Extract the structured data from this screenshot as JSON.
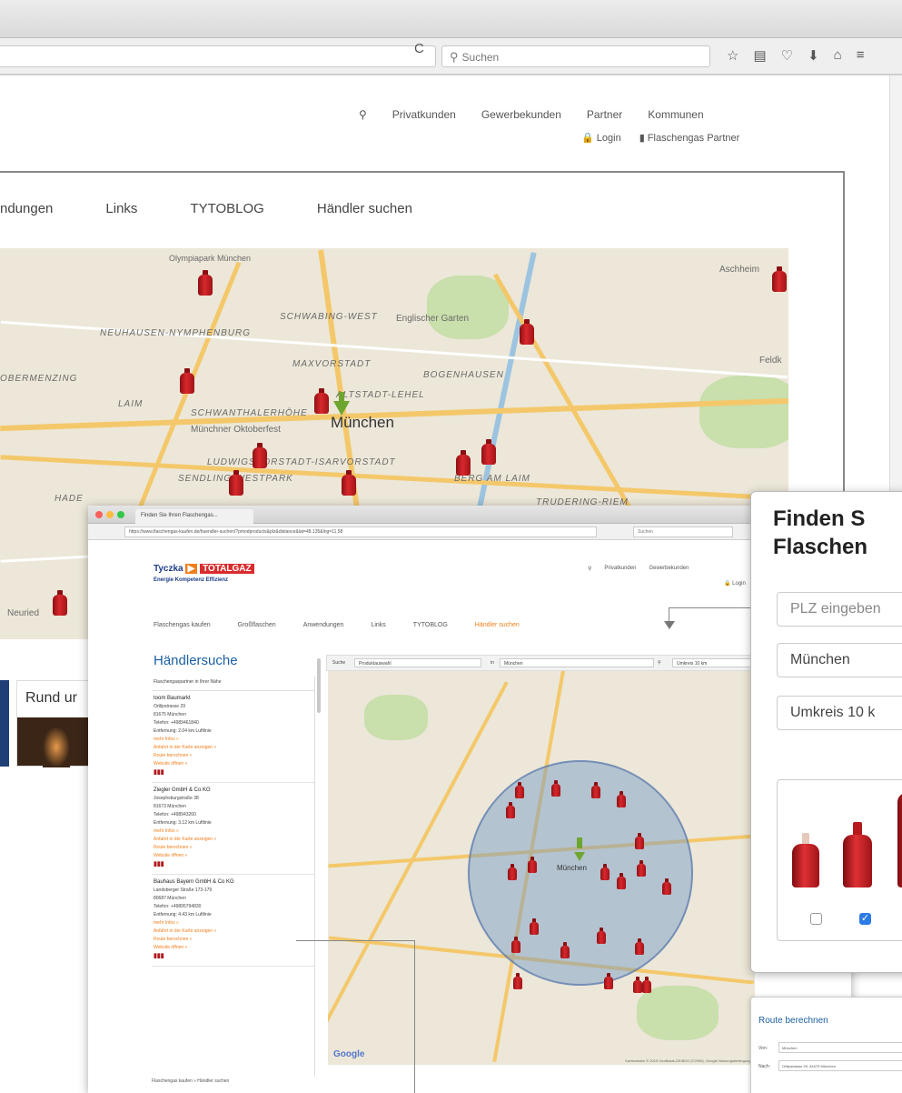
{
  "browser": {
    "search_placeholder": "Suchen",
    "reload_glyph": "C",
    "toolbar_icons": [
      "star-icon",
      "bookmarks-icon",
      "pocket-icon",
      "download-icon",
      "home-icon",
      "menu-icon"
    ]
  },
  "site": {
    "top_nav": [
      "Privatkunden",
      "Gewerbekunden",
      "Partner",
      "Kommunen"
    ],
    "login": "Login",
    "partner_link": "Flaschengas Partner",
    "main_nav": [
      "ndungen",
      "Links",
      "TYTOBLOG",
      "Händler suchen"
    ]
  },
  "map": {
    "city": "München",
    "places": [
      "Olympiapark München",
      "SCHWABING-WEST",
      "Englischer Garten",
      "NEUHAUSEN-NYMPHENBURG",
      "MAXVORSTADT",
      "BOGENHAUSEN",
      "OBERMENZING",
      "LAIM",
      "SCHWANTHALERHÖHE",
      "ALTSTADT-LEHEL",
      "Münchner Oktoberfest",
      "LUDWIGSVORSTADT-ISARVORSTADT",
      "SENDLING-WESTPARK",
      "BERG AM LAIM",
      "Aschheim",
      "Feldk",
      "Neuried",
      "TRUDERING-RIEM",
      "HADE"
    ],
    "teaser": "Rund ur"
  },
  "inset": {
    "tab_title": "Finden Sie Ihren Flaschengas...",
    "url": "https://www.flaschengas-kaufen.de/haendler-suchen/?pmodproducts&plz&distance&lat=48.135&lng=11.58",
    "search": "Suchen",
    "logo_left": "Tyczka",
    "logo_right": "TOTALGAZ",
    "logo_tagline": "Energie Kompetenz Effizienz",
    "top_nav": [
      "Privatkunden",
      "Gewerbekunden"
    ],
    "login": "Login",
    "nav": [
      "Flaschengas kaufen",
      "Großflaschen",
      "Anwendungen",
      "Links",
      "TYTOBLOG",
      "Händler suchen"
    ],
    "heading": "Händlersuche",
    "list_header": "Flaschengaspartner in Ihrer Nähe",
    "search_bar": {
      "label": "Suche",
      "product": "Produktauswahl",
      "in_label": "in",
      "city": "München",
      "radius": "Umkreis 10 km"
    },
    "dealers": [
      {
        "name": "toom Baumarkt",
        "street": "Ortlipstrasse 29",
        "city": "81675 München",
        "phone": "Telefon: +4989461840",
        "distance": "Entfernung: 2.04 km Luftlinie",
        "links": [
          "mehr Infos »",
          "Anfahrt in der Karte anzeigen »",
          "Route berechnen »",
          "Website öffnen »"
        ],
        "icons": "▮▮▮"
      },
      {
        "name": "Ziegler GmbH & Co KG",
        "street": "Josephsburgstraße 38",
        "city": "81673 München",
        "phone": "Telefon: +498943260",
        "distance": "Entfernung: 3.12 km Luftlinie",
        "links": [
          "mehr Infos »",
          "Anfahrt in der Karte anzeigen »",
          "Route berechnen »",
          "Website öffnen »"
        ],
        "icons": "▮▮▮"
      },
      {
        "name": "Bauhaus Bayern GmbH & Co KG",
        "street": "Landsberger Straße 173-179",
        "city": "80687 München",
        "phone": "Telefon: +49895794830",
        "distance": "Entfernung: 4.43 km Luftlinie",
        "links": [
          "mehr Infos »",
          "Anfahrt in der Karte anzeigen »",
          "Route berechnen »",
          "Website öffnen »"
        ],
        "icons": "▮▮▮"
      }
    ],
    "footer": "Flaschengas kaufen » Händler suchen",
    "map_city": "München",
    "google": "Google",
    "attribution": "Kartendaten © 2015 GeoBasis-DE/BKG (©2009), Google Nutzungsbedingungen"
  },
  "finden": {
    "heading_line1": "Finden S",
    "heading_line2": "Flaschen",
    "plz_placeholder": "PLZ eingeben",
    "city_value": "München",
    "radius_value": "Umkreis 10 k"
  },
  "route": {
    "heading": "Route berechnen",
    "von_label": "Von:",
    "von_value": "München",
    "nach_label": "Nach:",
    "nach_value": "Ortlipstrasse 29, 81675 München"
  },
  "colors": {
    "accent": "#f07e1b",
    "brand_blue": "#1c5fa3",
    "tank_red": "#c8202a",
    "checkbox_blue": "#2d7be6"
  }
}
